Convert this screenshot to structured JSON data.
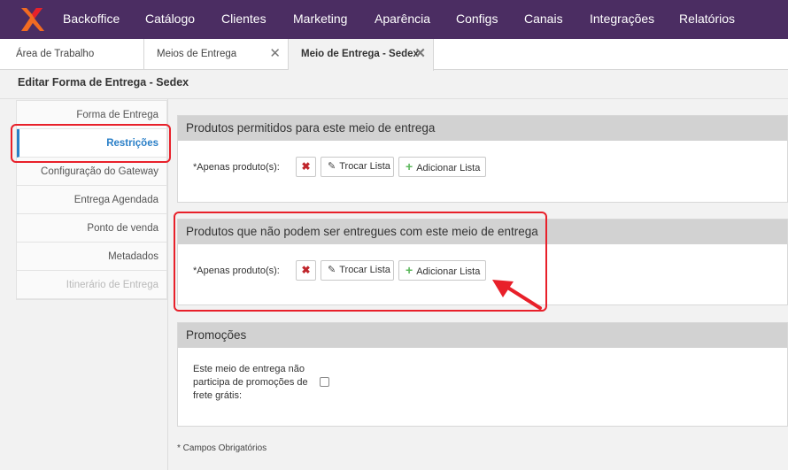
{
  "nav": {
    "items": [
      "Backoffice",
      "Catálogo",
      "Clientes",
      "Marketing",
      "Aparência",
      "Configs",
      "Canais",
      "Integrações",
      "Relatórios"
    ],
    "background": "#4b2d62"
  },
  "tabs": [
    {
      "label": "Área de Trabalho",
      "closable": false,
      "active": false
    },
    {
      "label": "Meios de Entrega",
      "closable": true,
      "active": false
    },
    {
      "label": "Meio de Entrega - Sedex",
      "closable": true,
      "active": true
    }
  ],
  "page": {
    "title": "Editar Forma de Entrega - Sedex"
  },
  "sidebar": {
    "items": [
      {
        "label": "Forma de Entrega",
        "state": "normal"
      },
      {
        "label": "Restrições",
        "state": "active"
      },
      {
        "label": "Configuração do Gateway",
        "state": "normal"
      },
      {
        "label": "Entrega Agendada",
        "state": "normal"
      },
      {
        "label": "Ponto de venda",
        "state": "normal"
      },
      {
        "label": "Metadados",
        "state": "normal"
      },
      {
        "label": "Itinerário de Entrega",
        "state": "disabled"
      }
    ]
  },
  "sections": {
    "allowed": {
      "title": "Produtos permitidos para este meio de entrega",
      "field_label": "*Apenas produto(s):",
      "remove_icon": "close-icon",
      "swap_label": "Trocar Lista",
      "add_label": "Adicionar Lista"
    },
    "blocked": {
      "title": "Produtos que não podem ser entregues com este meio de entrega",
      "field_label": "*Apenas produto(s):",
      "remove_icon": "close-icon",
      "swap_label": "Trocar Lista",
      "add_label": "Adicionar Lista"
    },
    "promotions": {
      "title": "Promoções",
      "checkbox_label": "Este meio de entrega não participa de promoções de frete grátis:",
      "checked": false
    }
  },
  "footnote": "* Campos Obrigatórios",
  "colors": {
    "accent": "#2a7fc7",
    "annotation": "#e8202a",
    "panel_header": "#d2d2d2",
    "remove": "#c0262c",
    "add": "#5cb85c"
  }
}
